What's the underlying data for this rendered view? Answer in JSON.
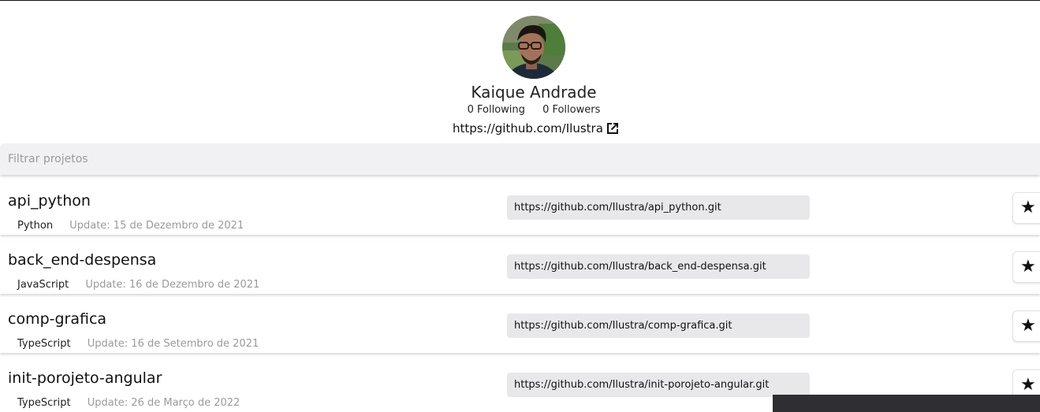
{
  "profile": {
    "name": "Kaique Andrade",
    "following": "0 Following",
    "followers": "0 Followers",
    "github_url": "https://github.com/Ilustra",
    "external_link_icon": "external-link-icon"
  },
  "filter": {
    "placeholder": "Filtrar projetos",
    "value": ""
  },
  "repos": [
    {
      "name": "api_python",
      "language": "Python",
      "updated": "Update: 15 de Dezembro de 2021",
      "clone_url": "https://github.com/Ilustra/api_python.git"
    },
    {
      "name": "back_end-despensa",
      "language": "JavaScript",
      "updated": "Update: 16 de Dezembro de 2021",
      "clone_url": "https://github.com/Ilustra/back_end-despensa.git"
    },
    {
      "name": "comp-grafica",
      "language": "TypeScript",
      "updated": "Update: 16 de Setembro de 2021",
      "clone_url": "https://github.com/Ilustra/comp-grafica.git"
    },
    {
      "name": "init-porojeto-angular",
      "language": "TypeScript",
      "updated": "Update: 26 de Março de 2022",
      "clone_url": "https://github.com/Ilustra/init-porojeto-angular.git"
    }
  ],
  "star_icon": "★",
  "colors": {
    "filter_bg": "#f1f1f3",
    "clone_bg": "#e8e8eb",
    "muted_text": "#9a9a9a"
  }
}
